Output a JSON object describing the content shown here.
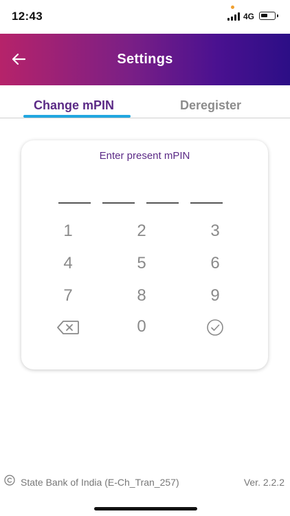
{
  "status_bar": {
    "time": "12:43",
    "network": "4G"
  },
  "header": {
    "title": "Settings",
    "back_icon": "arrow-left-icon",
    "gradient_colors": [
      "#b6236a",
      "#7a1f86",
      "#4a1190",
      "#2c0e86"
    ]
  },
  "tabs": {
    "items": [
      {
        "label": "Change mPIN",
        "active": true
      },
      {
        "label": "Deregister",
        "active": false
      }
    ],
    "accent_color": "#22a7e0",
    "active_text_color": "#5b2a86"
  },
  "pin_entry": {
    "prompt": "Enter present mPIN",
    "slot_count": 4
  },
  "keypad": {
    "keys": [
      "1",
      "2",
      "3",
      "4",
      "5",
      "6",
      "7",
      "8",
      "9",
      "0"
    ],
    "backspace_icon": "backspace-icon",
    "submit_icon": "check-circle-icon"
  },
  "footer": {
    "copyright_icon": "copyright-icon",
    "text": "State Bank of India (E-Ch_Tran_257)",
    "version": "Ver. 2.2.2"
  }
}
